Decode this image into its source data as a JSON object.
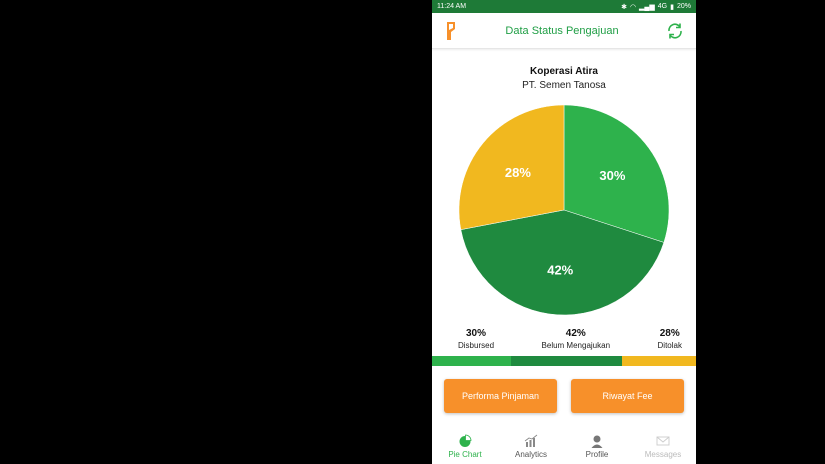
{
  "status_bar": {
    "time": "11:24 AM",
    "network": "4G",
    "battery": "20%"
  },
  "app_bar": {
    "title": "Data Status Pengajuan",
    "logo_icon": "app-logo-icon",
    "refresh_icon": "refresh-icon"
  },
  "company": {
    "name": "Koperasi Atira",
    "subtitle": "PT. Semen Tanosa"
  },
  "chart_data": {
    "type": "pie",
    "slices": [
      {
        "label": "Disbursed",
        "value": 30,
        "display": "30%",
        "color": "#2eb24c"
      },
      {
        "label": "Belum Mengajukan",
        "value": 42,
        "display": "42%",
        "color": "#1f8a3f"
      },
      {
        "label": "Ditolak",
        "value": 28,
        "display": "28%",
        "color": "#f1b81f"
      }
    ]
  },
  "legend": [
    {
      "pct": "30%",
      "label": "Disbursed"
    },
    {
      "pct": "42%",
      "label": "Belum Mengajukan"
    },
    {
      "pct": "28%",
      "label": "Ditolak"
    }
  ],
  "buttons": {
    "performa": "Performa Pinjaman",
    "riwayat": "Riwayat Fee"
  },
  "nav": [
    {
      "label": "Pie Chart",
      "icon": "pie-chart-icon"
    },
    {
      "label": "Analytics",
      "icon": "analytics-icon"
    },
    {
      "label": "Profile",
      "icon": "profile-icon"
    },
    {
      "label": "Messages",
      "icon": "messages-icon"
    }
  ],
  "colors": {
    "accent_green": "#1f9e45",
    "active_nav": "#2eb24c",
    "button_orange": "#f7902a",
    "status_bar": "#1e7a37"
  }
}
